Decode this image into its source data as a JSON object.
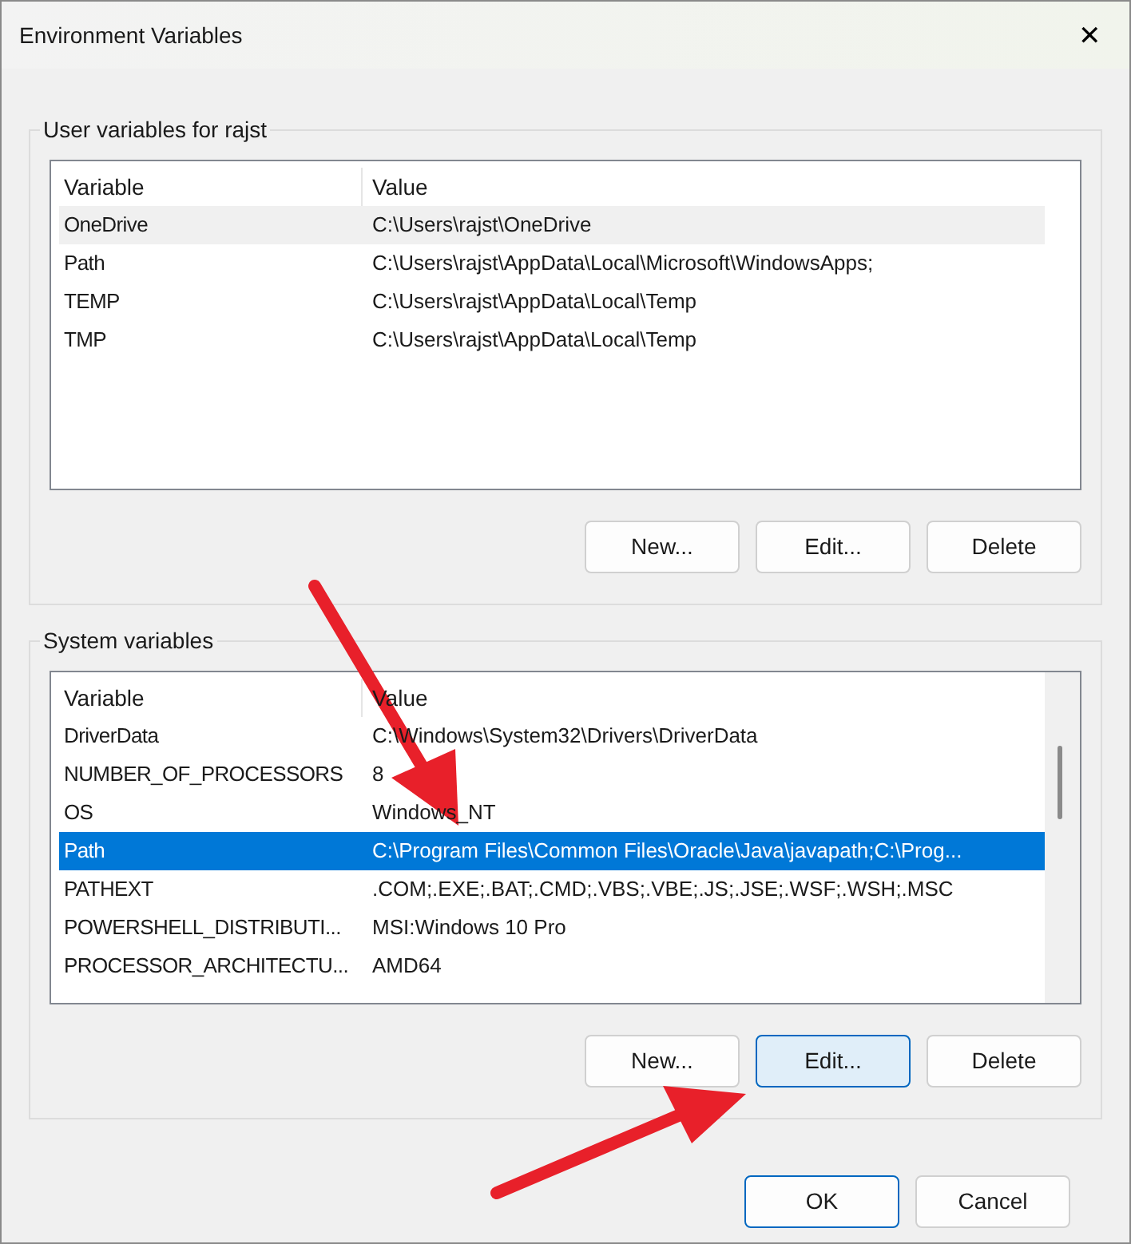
{
  "window": {
    "title": "Environment Variables",
    "close": "✕"
  },
  "groups": [
    {
      "title": "User variables for rajst",
      "columns": [
        "Variable",
        "Value"
      ],
      "scrollbar": false,
      "rows": [
        {
          "variable": "OneDrive",
          "value": "C:\\Users\\rajst\\OneDrive",
          "selected": false,
          "hovered": true
        },
        {
          "variable": "Path",
          "value": "C:\\Users\\rajst\\AppData\\Local\\Microsoft\\WindowsApps;",
          "selected": false,
          "hovered": false
        },
        {
          "variable": "TEMP",
          "value": "C:\\Users\\rajst\\AppData\\Local\\Temp",
          "selected": false,
          "hovered": false
        },
        {
          "variable": "TMP",
          "value": "C:\\Users\\rajst\\AppData\\Local\\Temp",
          "selected": false,
          "hovered": false
        }
      ],
      "buttons": [
        {
          "label": "New...",
          "hovered": false
        },
        {
          "label": "Edit...",
          "hovered": false
        },
        {
          "label": "Delete",
          "hovered": false
        }
      ]
    },
    {
      "title": "System variables",
      "columns": [
        "Variable",
        "Value"
      ],
      "scrollbar": true,
      "rows": [
        {
          "variable": "DriverData",
          "value": "C:\\Windows\\System32\\Drivers\\DriverData",
          "selected": false,
          "hovered": false
        },
        {
          "variable": "NUMBER_OF_PROCESSORS",
          "value": "8",
          "selected": false,
          "hovered": false
        },
        {
          "variable": "OS",
          "value": "Windows_NT",
          "selected": false,
          "hovered": false
        },
        {
          "variable": "Path",
          "value": "C:\\Program Files\\Common Files\\Oracle\\Java\\javapath;C:\\Prog...",
          "selected": true,
          "hovered": false
        },
        {
          "variable": "PATHEXT",
          "value": ".COM;.EXE;.BAT;.CMD;.VBS;.VBE;.JS;.JSE;.WSF;.WSH;.MSC",
          "selected": false,
          "hovered": false
        },
        {
          "variable": "POWERSHELL_DISTRIBUTI...",
          "value": "MSI:Windows 10 Pro",
          "selected": false,
          "hovered": false
        },
        {
          "variable": "PROCESSOR_ARCHITECTU...",
          "value": "AMD64",
          "selected": false,
          "hovered": false
        }
      ],
      "buttons": [
        {
          "label": "New...",
          "hovered": false
        },
        {
          "label": "Edit...",
          "hovered": true
        },
        {
          "label": "Delete",
          "hovered": false
        }
      ]
    }
  ],
  "footer_buttons": [
    {
      "label": "OK",
      "default": true
    },
    {
      "label": "Cancel",
      "default": false
    }
  ]
}
